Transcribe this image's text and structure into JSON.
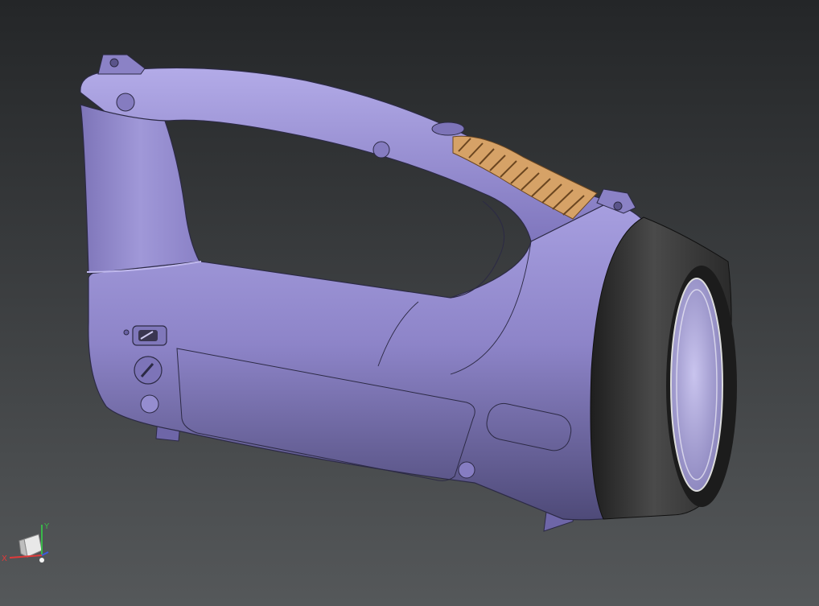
{
  "viewport": {
    "background_top": "#242628",
    "background_bottom": "#55585a"
  },
  "model": {
    "body_color": "#8d84c8",
    "body_shadow_color": "#4e4a78",
    "bezel_color": "#2e2e2e",
    "grip_color": "#d6a267",
    "lens_color": "#b9b4e2"
  },
  "triad": {
    "x_label": "X",
    "y_label": "Y",
    "x_color": "#e03a3a",
    "y_color": "#3ab84a",
    "z_color": "#3a5ae0"
  }
}
